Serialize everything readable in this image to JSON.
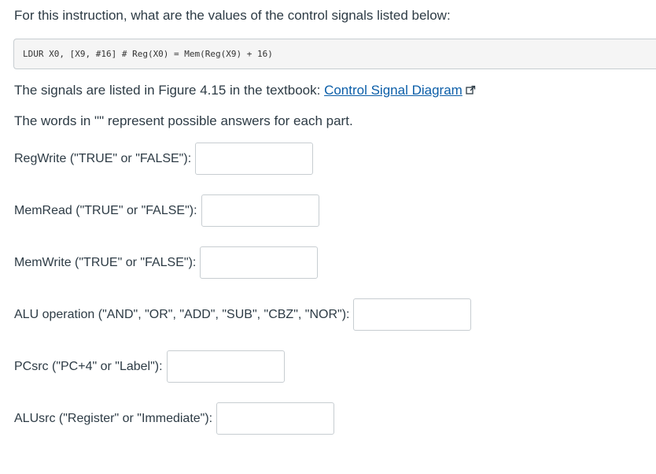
{
  "question": "For this instruction, what are the values of the control signals listed below:",
  "code": "LDUR X0, [X9, #16] # Reg(X0) = Mem(Reg(X9) + 16)",
  "reference": {
    "prefix": "The signals are listed in Figure 4.15 in the textbook: ",
    "link_text": "Control Signal Diagram",
    "link_icon": "external-link-icon"
  },
  "note": "The words in \"\" represent possible answers for each part.",
  "fields": [
    {
      "label": "RegWrite (\"TRUE\" or \"FALSE\"):",
      "value": ""
    },
    {
      "label": "MemRead (\"TRUE\" or \"FALSE\"):",
      "value": ""
    },
    {
      "label": "MemWrite (\"TRUE\" or \"FALSE\"):",
      "value": ""
    },
    {
      "label": "ALU operation (\"AND\", \"OR\", \"ADD\", \"SUB\", \"CBZ\", \"NOR\"):",
      "value": ""
    },
    {
      "label": "PCsrc (\"PC+4\" or \"Label\"):",
      "value": ""
    },
    {
      "label": "ALUsrc (\"Register\" or \"Immediate\"):",
      "value": ""
    }
  ],
  "colors": {
    "text": "#2d3b45",
    "link": "#0b5ea8",
    "code_background": "#f5f5f5",
    "border": "#c7cdd1"
  }
}
